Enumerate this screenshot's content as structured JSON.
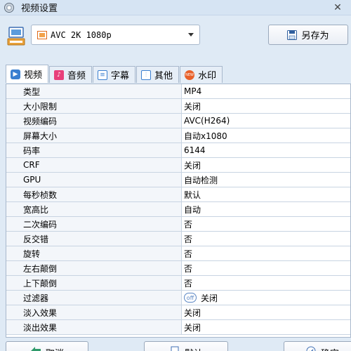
{
  "window": {
    "title": "视频设置",
    "close_glyph": "✕"
  },
  "toolbar": {
    "format_value": "AVC 2K 1080p",
    "save_as_label": "另存为"
  },
  "tabs": [
    {
      "label": "视频",
      "icon": "video-tab-icon",
      "color": "#3a7fd0"
    },
    {
      "label": "音频",
      "icon": "music-tab-icon",
      "color": "#e8407a"
    },
    {
      "label": "字幕",
      "icon": "subtitle-tab-icon",
      "color": "#3a7fd0"
    },
    {
      "label": "其他",
      "icon": "sliders-tab-icon",
      "color": "#3a7fd0"
    },
    {
      "label": "水印",
      "icon": "watermark-tab-icon",
      "color": "#e8602a",
      "icon_text": "NEW"
    }
  ],
  "properties": [
    {
      "label": "类型",
      "value": "MP4"
    },
    {
      "label": "大小限制",
      "value": "关闭"
    },
    {
      "label": "视频编码",
      "value": "AVC(H264)"
    },
    {
      "label": "屏幕大小",
      "value": "自动x1080"
    },
    {
      "label": "码率",
      "value": "6144"
    },
    {
      "label": "CRF",
      "value": "关闭"
    },
    {
      "label": "GPU",
      "value": "自动检测"
    },
    {
      "label": "每秒桢数",
      "value": "默认"
    },
    {
      "label": "宽高比",
      "value": "自动"
    },
    {
      "label": "二次编码",
      "value": "否"
    },
    {
      "label": "反交错",
      "value": "否"
    },
    {
      "label": "旋转",
      "value": "否"
    },
    {
      "label": "左右颠倒",
      "value": "否"
    },
    {
      "label": "上下颠倒",
      "value": "否"
    },
    {
      "label": "过滤器",
      "value": "关闭",
      "badge": "off"
    },
    {
      "label": "淡入效果",
      "value": "关闭"
    },
    {
      "label": "淡出效果",
      "value": "关闭"
    }
  ],
  "buttons": {
    "cancel_label": "取消",
    "default_label": "默认",
    "ok_label": "确定"
  }
}
